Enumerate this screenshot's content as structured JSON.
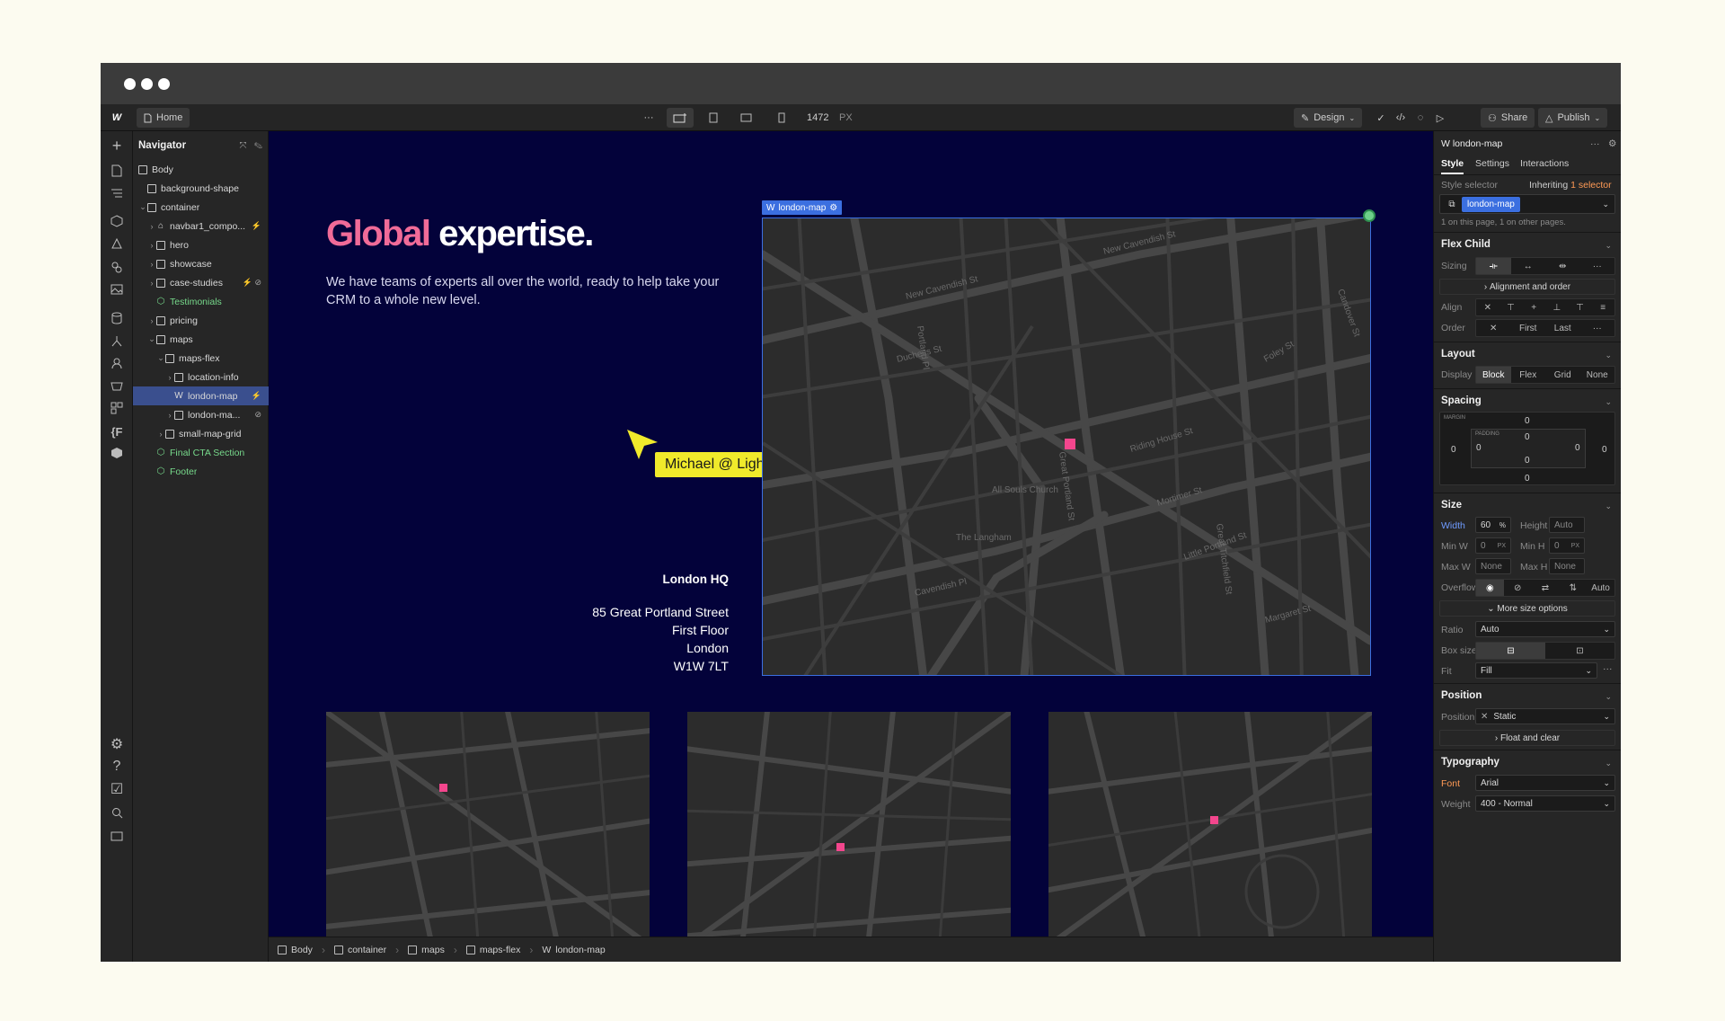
{
  "toolbar": {
    "home_label": "Home",
    "width_value": "1472",
    "width_unit": "PX",
    "design_label": "Design",
    "share_label": "Share",
    "publish_label": "Publish"
  },
  "navigator": {
    "title": "Navigator",
    "items": [
      {
        "label": "Body"
      },
      {
        "label": "background-shape"
      },
      {
        "label": "container"
      },
      {
        "label": "navbar1_compo..."
      },
      {
        "label": "hero"
      },
      {
        "label": "showcase"
      },
      {
        "label": "case-studies"
      },
      {
        "label": "Testimonials"
      },
      {
        "label": "pricing"
      },
      {
        "label": "maps"
      },
      {
        "label": "maps-flex"
      },
      {
        "label": "location-info"
      },
      {
        "label": "london-map"
      },
      {
        "label": "london-ma..."
      },
      {
        "label": "small-map-grid"
      },
      {
        "label": "Final CTA Section"
      },
      {
        "label": "Footer"
      }
    ]
  },
  "canvas": {
    "headline_highlight": "Global",
    "headline_rest": " expertise.",
    "subtitle": "We have teams of experts all over the world, ready to help take your CRM to a whole new level.",
    "cursor_label": "Michael @ Lightning UX",
    "address": {
      "title": "London HQ",
      "line1": "85 Great Portland Street",
      "line2": "First Floor",
      "line3": "London",
      "line4": "W1W 7LT"
    },
    "map_tag": "london-map",
    "streets": [
      "New Cavendish St",
      "New Cavendish St",
      "Great Portland St",
      "Mortimer St",
      "Riding House St",
      "Cavendish Pl",
      "Margaret St",
      "Great Titchfield St",
      "Foley St",
      "Duchess St",
      "Portland Pl",
      "The Langham",
      "All Souls Church",
      "Little Portland St",
      "Candover St"
    ]
  },
  "breadcrumbs": [
    "Body",
    "container",
    "maps",
    "maps-flex",
    "london-map"
  ],
  "panel": {
    "element_name": "london-map",
    "tabs": [
      "Style",
      "Settings",
      "Interactions"
    ],
    "style_selector_label": "Style selector",
    "inheriting_label": "Inheriting",
    "inheriting_count": "1 selector",
    "selector_chip": "london-map",
    "selector_note": "1 on this page, 1 on other pages.",
    "flex_child": "Flex Child",
    "sizing_label": "Sizing",
    "alignment_order": "Alignment and order",
    "align_label": "Align",
    "order_label": "Order",
    "order_first": "First",
    "order_last": "Last",
    "layout_title": "Layout",
    "display_label": "Display",
    "display_options": [
      "Block",
      "Flex",
      "Grid",
      "None"
    ],
    "spacing_title": "Spacing",
    "margin_label": "MARGIN",
    "padding_label": "PADDING",
    "spacing_values": [
      "0",
      "0",
      "0",
      "0",
      "0",
      "0",
      "0",
      "0"
    ],
    "size_title": "Size",
    "width_label": "Width",
    "width_value": "60",
    "width_unit": "%",
    "height_label": "Height",
    "height_value": "Auto",
    "minw_label": "Min W",
    "minw_value": "0",
    "minw_unit": "PX",
    "minh_label": "Min H",
    "minh_value": "0",
    "minh_unit": "PX",
    "maxw_label": "Max W",
    "maxw_value": "None",
    "maxh_label": "Max H",
    "maxh_value": "None",
    "overflow_label": "Overflow",
    "overflow_auto": "Auto",
    "more_size": "More size options",
    "ratio_label": "Ratio",
    "ratio_value": "Auto",
    "boxsize_label": "Box size",
    "fit_label": "Fit",
    "fit_value": "Fill",
    "position_title": "Position",
    "position_label": "Position",
    "position_value": "Static",
    "float_clear": "Float and clear",
    "typography_title": "Typography",
    "font_label": "Font",
    "font_value": "Arial",
    "weight_label": "Weight",
    "weight_value": "400 - Normal"
  },
  "colors": {
    "canvas_bg": "#03023a",
    "headline_pink": "#f06b98",
    "selection_blue": "#3b6fe0",
    "pin_pink": "#f3468d",
    "cursor_yellow": "#f0ea2b",
    "navigator_green": "#77d98b"
  }
}
